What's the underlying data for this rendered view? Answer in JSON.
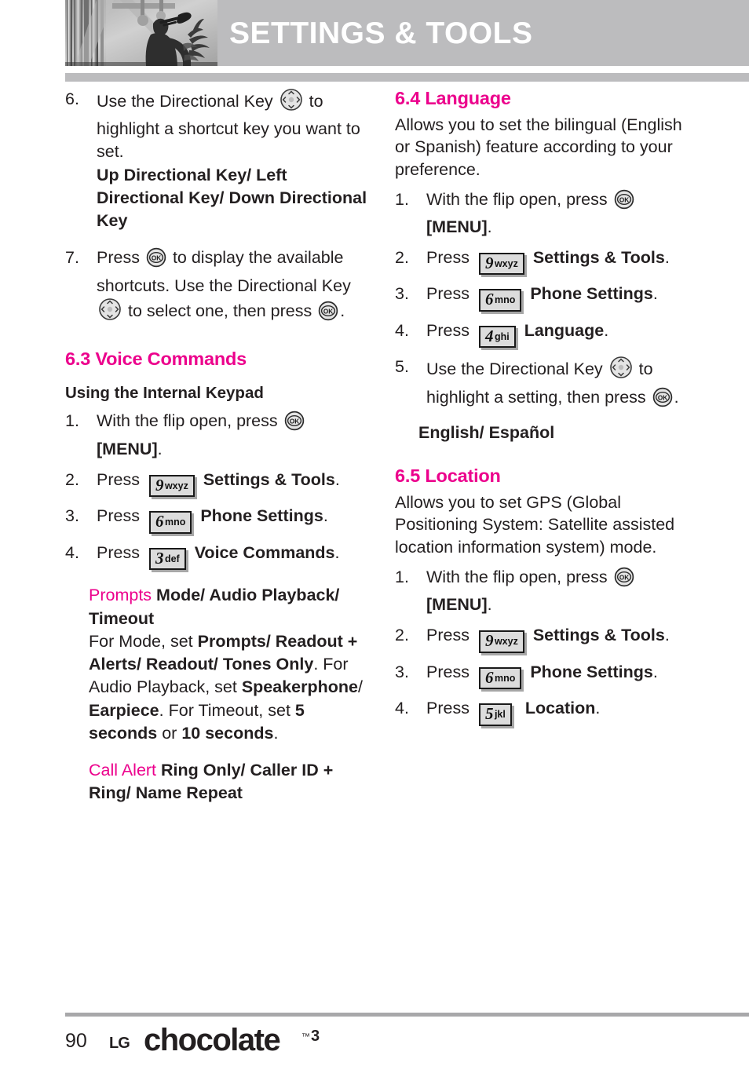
{
  "header": {
    "title": "SETTINGS & TOOLS",
    "photo_alt": "trumpet-player-photo",
    "bar_color": "#bcbcbe"
  },
  "colors": {
    "accent_magenta": "#ec008c",
    "header_gray": "#bcbcbe",
    "body_black": "#231f20",
    "key_fill": "#dcdcdc"
  },
  "left_column": {
    "step6": {
      "num": "6.",
      "text_a": "Use the Directional Key",
      "text_b": "to highlight a shortcut key you want to set.",
      "bold_line": "Up Directional Key/ Left Directional Key/ Down Directional Key"
    },
    "step7": {
      "num": "7.",
      "text_a": "Press",
      "text_b": "to display the available shortcuts. Use the Directional Key",
      "text_c": "to select one, then press",
      "text_d": "."
    },
    "section_6_3": {
      "heading": "6.3 Voice Commands",
      "subheading": "Using the Internal Keypad",
      "steps": [
        {
          "num": "1.",
          "text_a": "With the flip open, press",
          "bold_after": "[MENU]",
          "text_b": "."
        },
        {
          "num": "2.",
          "text_a": "Press",
          "key_digit": "9",
          "key_letters": "wxyz",
          "bold_after": "Settings & Tools",
          "text_b": "."
        },
        {
          "num": "3.",
          "text_a": "Press",
          "key_digit": "6",
          "key_letters": "mno",
          "bold_after": "Phone Settings",
          "text_b": "."
        },
        {
          "num": "4.",
          "text_a": "Press",
          "key_digit": "3",
          "key_letters": "def",
          "bold_after": "Voice Commands",
          "text_b": "."
        }
      ],
      "detail_prompts": {
        "term": "Prompts",
        "options": "Mode/ Audio Playback/ Timeout",
        "desc_1a": "For Mode, set ",
        "desc_1b": "Prompts/ Readout + Alerts/ Readout/ Tones Only",
        "desc_1c": ".",
        "desc_2a": "For Audio Playback, set ",
        "desc_2b": "Speakerphone",
        "desc_2c": "/ ",
        "desc_2d": "Earpiece",
        "desc_2e": ". For Timeout, set ",
        "desc_2f": "5 seconds",
        "desc_2g": " or ",
        "desc_2h": "10 seconds",
        "desc_2i": "."
      },
      "detail_call_alert": {
        "term": "Call Alert",
        "options": "Ring Only/ Caller ID + Ring/ Name Repeat"
      }
    }
  },
  "right_column": {
    "section_6_4": {
      "heading": "6.4 Language",
      "intro": "Allows you to set the bilingual (English or Spanish) feature according to your preference.",
      "steps": [
        {
          "num": "1.",
          "text_a": "With the flip open, press",
          "bold_after": "[MENU]",
          "text_b": "."
        },
        {
          "num": "2.",
          "text_a": "Press",
          "key_digit": "9",
          "key_letters": "wxyz",
          "bold_after": "Settings & Tools",
          "text_b": "."
        },
        {
          "num": "3.",
          "text_a": "Press",
          "key_digit": "6",
          "key_letters": "mno",
          "bold_after": "Phone Settings",
          "text_b": "."
        },
        {
          "num": "4.",
          "text_a": "Press",
          "key_digit": "4",
          "key_letters": "ghi",
          "bold_after": "Language",
          "text_b": "."
        },
        {
          "num": "5.",
          "text_a": "Use the Directional Key",
          "text_b": "to highlight a setting, then press",
          "text_c": "."
        }
      ],
      "options_line": "English/ Español"
    },
    "section_6_5": {
      "heading": "6.5 Location",
      "intro": "Allows you to set GPS (Global Positioning System: Satellite assisted location information system) mode.",
      "steps": [
        {
          "num": "1.",
          "text_a": "With the flip open, press",
          "bold_after": "[MENU]",
          "text_b": "."
        },
        {
          "num": "2.",
          "text_a": "Press",
          "key_digit": "9",
          "key_letters": "wxyz",
          "bold_after": "Settings & Tools",
          "text_b": "."
        },
        {
          "num": "3.",
          "text_a": "Press",
          "key_digit": "6",
          "key_letters": "mno",
          "bold_after": "Phone Settings",
          "text_b": "."
        },
        {
          "num": "4.",
          "text_a": "Press",
          "key_digit": "5",
          "key_letters": "jkl",
          "bold_after": "Location",
          "text_b": "."
        }
      ]
    }
  },
  "footer": {
    "page_number": "90",
    "logo_lg": "LG",
    "logo_product": "chocolate",
    "logo_tm": "™",
    "logo_version": "3"
  }
}
